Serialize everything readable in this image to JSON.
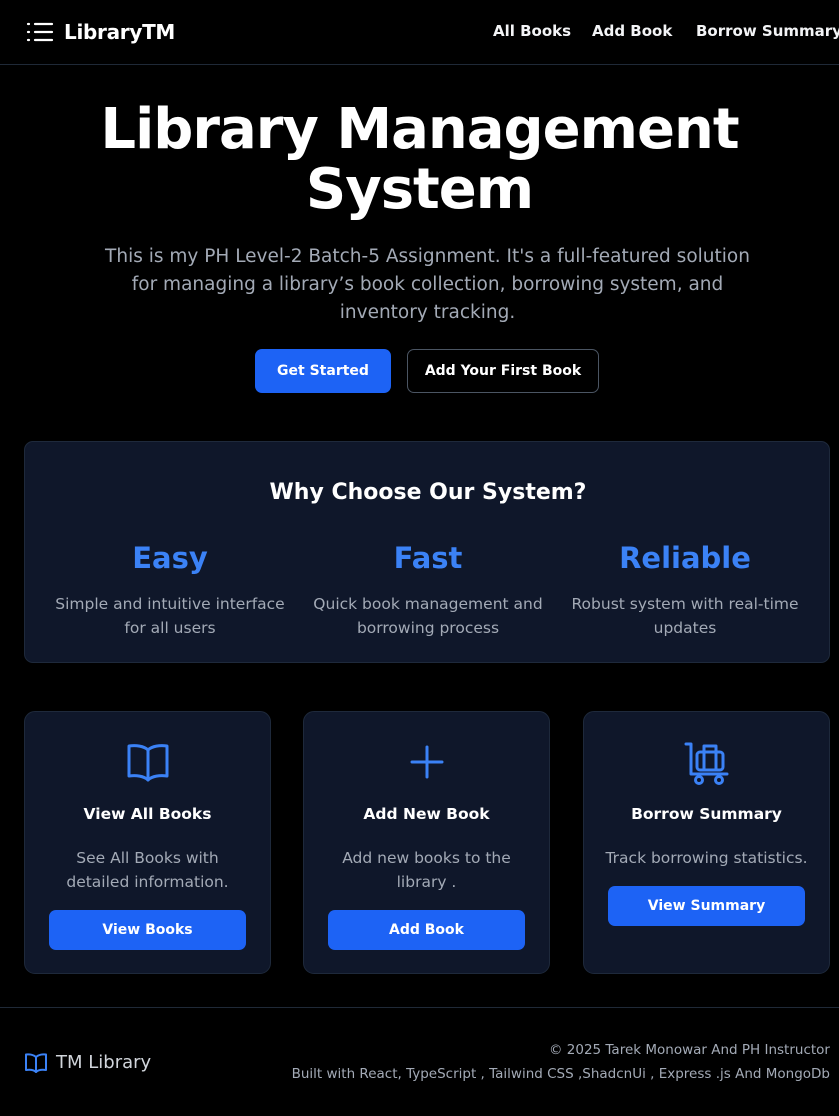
{
  "navbar": {
    "brand": "LibraryTM",
    "links": [
      "All Books",
      "Add Book",
      "Borrow Summary"
    ]
  },
  "hero": {
    "title_line1": "Library Management",
    "title_line2": "System",
    "description": "This is my PH Level-2 Batch-5 Assignment. It's a full-featured solution for managing a library’s book collection, borrowing system, and inventory tracking.",
    "primary_button": "Get Started",
    "secondary_button": "Add Your First Book"
  },
  "why": {
    "title": "Why Choose Our System?",
    "features": [
      {
        "title": "Easy",
        "description": "Simple and intuitive interface for all users"
      },
      {
        "title": "Fast",
        "description": "Quick book management and borrowing process"
      },
      {
        "title": "Reliable",
        "description": "Robust system with real-time updates"
      }
    ]
  },
  "actions": [
    {
      "icon": "book-open-icon",
      "title": "View All Books",
      "description": "See All Books with detailed information.",
      "button": "View Books"
    },
    {
      "icon": "plus-icon",
      "title": "Add New Book",
      "description": "Add new books to the library .",
      "button": "Add Book"
    },
    {
      "icon": "luggage-cart-icon",
      "title": "Borrow Summary",
      "description": "Track borrowing statistics.",
      "button": "View Summary"
    }
  ],
  "footer": {
    "brand": "TM Library",
    "copyright": "© 2025 Tarek Monowar And PH Instructor",
    "built_with": "Built with React, TypeScript , Tailwind CSS ,ShadcnUi , Express .js And MongoDb"
  },
  "colors": {
    "background": "#000000",
    "card": "#0f172a",
    "accent": "#1d63f5",
    "accent_text": "#3b82f6",
    "muted_text": "#a3aab6"
  }
}
